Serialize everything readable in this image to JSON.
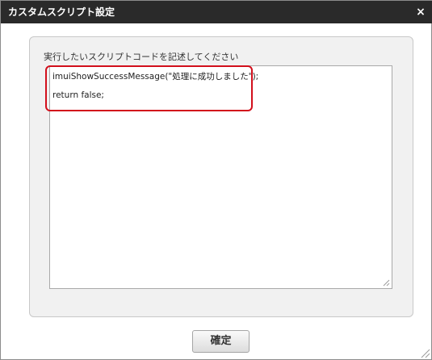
{
  "dialog": {
    "title": "カスタムスクリプト設定",
    "close_icon": "close-icon",
    "close_symbol": "×"
  },
  "editor": {
    "label": "実行したいスクリプトコードを記述してください",
    "code_lines": [
      "imuiShowSuccessMessage(\"処理に成功しました\");",
      "return false;"
    ],
    "highlight_color": "#d20f1c"
  },
  "footer": {
    "confirm_label": "確定"
  },
  "colors": {
    "titlebar": "#2a2a2a",
    "panel": "#f1f1f1",
    "highlight": "#d20f1c"
  }
}
